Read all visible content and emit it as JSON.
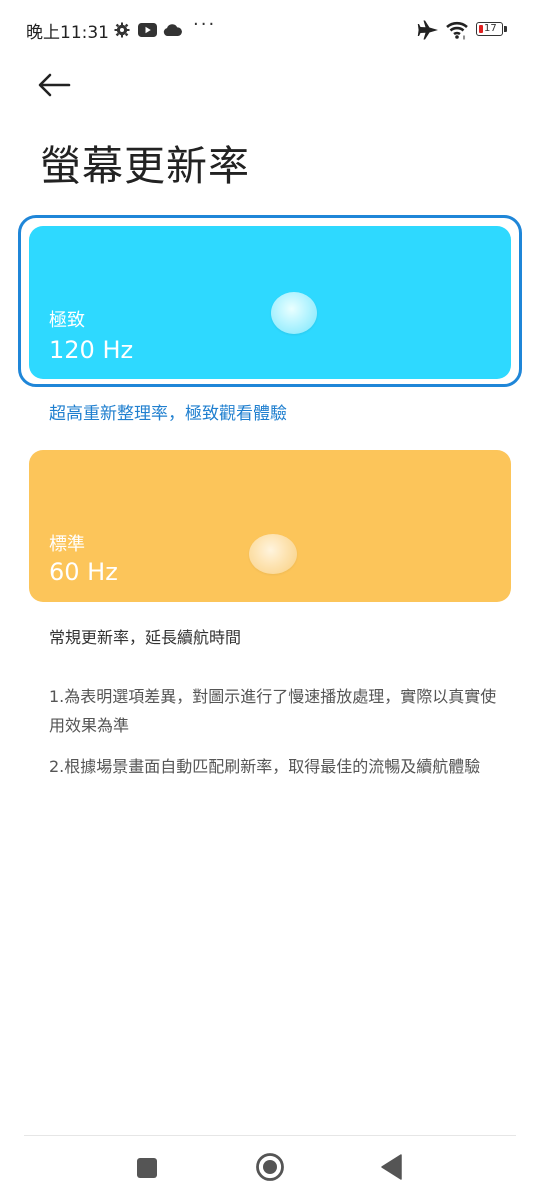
{
  "status_bar": {
    "time": "晚上11:31",
    "more": "···",
    "battery_level": "17",
    "icons": [
      "settings-gear-icon",
      "youtube-icon",
      "cloud-icon",
      "airplane-mode-icon",
      "wifi-icon",
      "battery-icon"
    ]
  },
  "header": {
    "back_icon": "arrow-left-icon",
    "title": "螢幕更新率"
  },
  "options": [
    {
      "name": "極致",
      "rate": "120 Hz",
      "description": "超高重新整理率，極致觀看體驗",
      "selected": true,
      "color": "#2ed9ff"
    },
    {
      "name": "標準",
      "rate": "60 Hz",
      "description": "常規更新率，延長續航時間",
      "selected": false,
      "color": "#fcc55a"
    }
  ],
  "notes": [
    "1.為表明選項差異，對圖示進行了慢速播放處理，實際以真實使用效果為準",
    "2.根據場景畫面自動匹配刷新率，取得最佳的流暢及續航體驗"
  ],
  "accent_color": "#1f86d8",
  "nav_bar": {
    "icons": [
      "recents-square-icon",
      "home-circle-icon",
      "back-triangle-icon"
    ]
  }
}
